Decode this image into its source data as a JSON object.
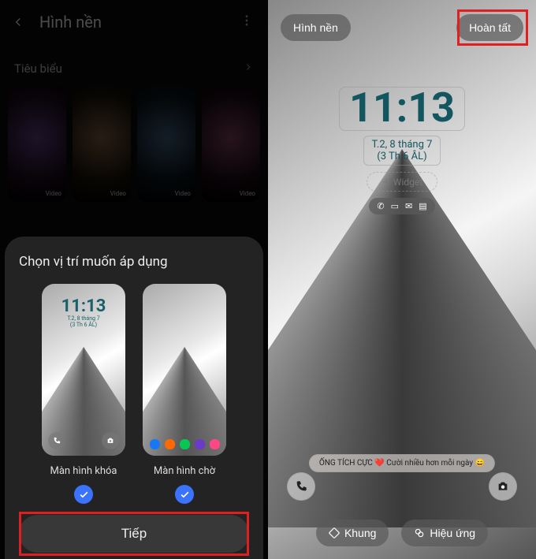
{
  "left": {
    "header_title": "Hình nền",
    "section_title": "Tiêu biểu",
    "video_tag": "Video"
  },
  "sheet": {
    "title": "Chọn vị trí muốn áp dụng",
    "lock_label": "Màn hình khóa",
    "home_label": "Màn hình chờ",
    "preview_time": "11:13",
    "preview_date_line1": "T.2, 8 tháng 7",
    "preview_date_line2": "(3 Th 6 ÂL)",
    "next_label": "Tiếp"
  },
  "right": {
    "top_left": "Hình nền",
    "top_right": "Hoàn tất",
    "clock": "11:13",
    "date_line1": "T.2, 8 tháng 7",
    "date_line2": "(3 Th 6 ÂL)",
    "widget_label": "＋ Widget",
    "caption": "ỐNG TÍCH CỰC ❤️ Cười nhiều hơn mỗi ngày 😄",
    "bottom_left": "Khung",
    "bottom_right": "Hiệu ứng"
  }
}
